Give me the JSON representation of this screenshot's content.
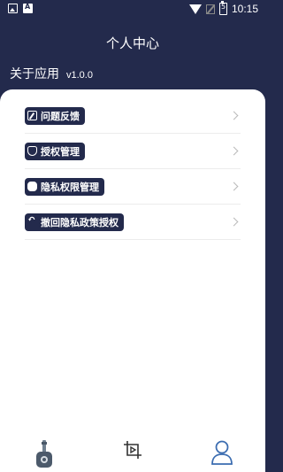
{
  "status": {
    "time": "10:15",
    "battery": "5"
  },
  "header": {
    "title": "个人中心"
  },
  "about": {
    "label": "关于应用",
    "version": "v1.0.0"
  },
  "menu": {
    "items": [
      {
        "label": "问题反馈",
        "icon": "edit-icon"
      },
      {
        "label": "授权管理",
        "icon": "shield-icon"
      },
      {
        "label": "隐私权限管理",
        "icon": "hand-icon"
      },
      {
        "label": "撤回隐私政策授权",
        "icon": "undo-icon"
      }
    ]
  },
  "bottom_nav": {
    "tabs": [
      {
        "icon": "guitar-icon"
      },
      {
        "icon": "video-crop-icon"
      },
      {
        "icon": "person-icon",
        "active": true
      }
    ]
  },
  "colors": {
    "header_bg": "#232a4c",
    "accent": "#3b6cb0"
  }
}
